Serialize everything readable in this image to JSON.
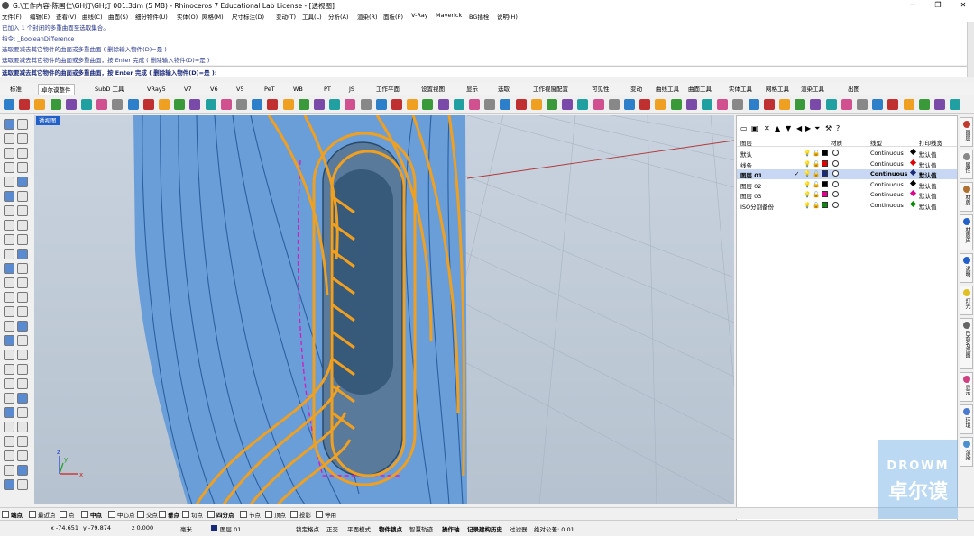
{
  "window": {
    "title": "G:\\工作内容-陈国仁\\GH灯\\GH灯 001.3dm (5 MB) - Rhinoceros 7 Educational Lab License - [透视图]",
    "minimize_glyph": "─",
    "maximize_glyph": "❐",
    "close_glyph": "✕"
  },
  "menu": [
    "文件(F)",
    "编辑(E)",
    "查看(V)",
    "曲线(C)",
    "曲面(S)",
    "细分物件(U)",
    "实体(O)",
    "网格(M)",
    "尺寸标注(D)",
    "变动(T)",
    "工具(L)",
    "分析(A)",
    "渲染(R)",
    "面板(P)",
    "V-Ray",
    "Maverick",
    "BG插栓",
    "说明(H)"
  ],
  "command_history": [
    "已加入 1 个封闭的多重曲面至选取集合。",
    "指令: _BooleanDifference",
    "选取要减去其它物件的曲面或多重曲面 ( 删除输入物件(D)=是 )",
    "选取要减去其它物件的曲面或多重曲面，按 Enter 完成 ( 删除输入物件(D)=是 )"
  ],
  "command_prompt": "选取要减去其它物件的曲面或多重曲面，按 Enter 完成 ( 删除输入物件(D)=是 ):",
  "toolbar_tabs": [
    "标准",
    "卓尔谟整件",
    "SubD 工具",
    "VRay5",
    "V7",
    "V6",
    "V5",
    "PeT",
    "WB",
    "PT",
    "JS",
    "工作平面",
    "设置视图",
    "显示",
    "选取",
    "工作视窗配置",
    "可见性",
    "变动",
    "曲线工具",
    "曲面工具",
    "实体工具",
    "网格工具",
    "渲染工具",
    "出图"
  ],
  "active_tab_index": 1,
  "viewport": {
    "label": "透视图",
    "axis_x": "x",
    "axis_y": "y",
    "axis_z": "z"
  },
  "layers_panel": {
    "columns": [
      "图层",
      "材质",
      "线型",
      "打印线宽"
    ],
    "rows": [
      {
        "name": "默认",
        "color": "#000000",
        "linetype": "Continuous",
        "print_color": "#000000",
        "print_width": "默认值",
        "selected": false,
        "current": false
      },
      {
        "name": "线条",
        "color": "#e00000",
        "linetype": "Continuous",
        "print_color": "#e00000",
        "print_width": "默认值",
        "selected": false,
        "current": false
      },
      {
        "name": "图层 01",
        "color": "#1a2a7a",
        "linetype": "Continuous",
        "print_color": "#1a2a7a",
        "print_width": "默认值",
        "selected": true,
        "current": true
      },
      {
        "name": "图层 02",
        "color": "#000000",
        "linetype": "Continuous",
        "print_color": "#000000",
        "print_width": "默认值",
        "selected": false,
        "current": false
      },
      {
        "name": "图层 03",
        "color": "#e0008c",
        "linetype": "Continuous",
        "print_color": "#e0008c",
        "print_width": "默认值",
        "selected": false,
        "current": false
      },
      {
        "name": "ISO分割备份",
        "color": "#0a8a0a",
        "linetype": "Continuous",
        "print_color": "#0a8a0a",
        "print_width": "默认值",
        "selected": false,
        "current": false
      }
    ]
  },
  "side_tabs": [
    {
      "label": "图层",
      "color": "#c0392b"
    },
    {
      "label": "属性",
      "color": "#888888"
    },
    {
      "label": "材质",
      "color": "#b07030"
    },
    {
      "label": "材质库",
      "color": "#2060c8"
    },
    {
      "label": "说明",
      "color": "#2060c8"
    },
    {
      "label": "灯光",
      "color": "#e0c020"
    },
    {
      "label": "已命名视图",
      "color": "#666666"
    },
    {
      "label": "显示",
      "color": "#d04080"
    },
    {
      "label": "环境",
      "color": "#4a7ad0"
    },
    {
      "label": "渲染",
      "color": "#4a90d0"
    }
  ],
  "osnap": [
    {
      "label": "端点",
      "checked": true
    },
    {
      "label": "最近点",
      "checked": false
    },
    {
      "label": "点",
      "checked": false
    },
    {
      "label": "中点",
      "checked": true
    },
    {
      "label": "中心点",
      "checked": false
    },
    {
      "label": "交点",
      "checked": false
    },
    {
      "label": "垂点",
      "checked": true
    },
    {
      "label": "切点",
      "checked": false
    },
    {
      "label": "四分点",
      "checked": true
    },
    {
      "label": "节点",
      "checked": false
    },
    {
      "label": "顶点",
      "checked": false
    },
    {
      "label": "投影",
      "checked": false
    },
    {
      "label": "停用",
      "checked": false
    }
  ],
  "status": {
    "x_coord": "x -74.651",
    "y_coord": "y -79.874",
    "z_coord": "z 0.000",
    "units": "毫米",
    "layer": "图层 01",
    "grid_snap": "锁定格点",
    "ortho": "正交",
    "planar": "平面模式",
    "osnap_toggle": "物件锁点",
    "smarttrack": "智慧轨迹",
    "gumball": "操作轴",
    "history": "记录建构历史",
    "filter": "过滤器",
    "tolerance": "绝对公差: 0.01"
  },
  "watermark": {
    "line1": "DROWM",
    "line2": "卓尔谟"
  }
}
